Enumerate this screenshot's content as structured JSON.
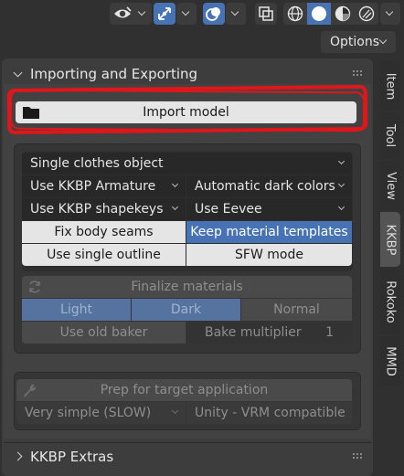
{
  "header": {
    "options_label": "Options",
    "icons": [
      "visibility-eye-icon",
      "gizmo-icon",
      "overlay-icon",
      "xray-icon",
      "wireframe-shading-icon",
      "solid-shading-icon",
      "material-preview-icon",
      "rendered-shading-icon"
    ],
    "active_shading": "solid"
  },
  "panel": {
    "title": "Importing and Exporting",
    "import_button": "Import model",
    "dropdowns": {
      "single_clothes": "Single clothes object",
      "armature": "Use KKBP Armature",
      "dark_colors": "Automatic dark colors",
      "shapekeys": "Use KKBP shapekeys",
      "eevee": "Use Eevee"
    },
    "buttons": {
      "fix_body_seams": "Fix body seams",
      "keep_templates": "Keep material templates",
      "single_outline": "Use single outline",
      "sfw_mode": "SFW mode"
    },
    "finalize": {
      "title": "Finalize materials",
      "light": "Light",
      "dark": "Dark",
      "normal": "Normal",
      "old_baker": "Use old baker",
      "bake_multiplier_label": "Bake multiplier",
      "bake_multiplier_value": "1"
    },
    "prep": {
      "title": "Prep for target application",
      "simplify": "Very simple (SLOW)",
      "target": "Unity - VRM compatible"
    },
    "extras_title": "KKBP Extras"
  },
  "tabs": [
    "Item",
    "Tool",
    "View",
    "KKBP",
    "Rokoko",
    "MMD"
  ],
  "active_tab": "KKBP",
  "colors": {
    "accent_blue": "#4772b3",
    "highlight_red": "#e0161a",
    "panel_bg": "#3d3d3d"
  }
}
